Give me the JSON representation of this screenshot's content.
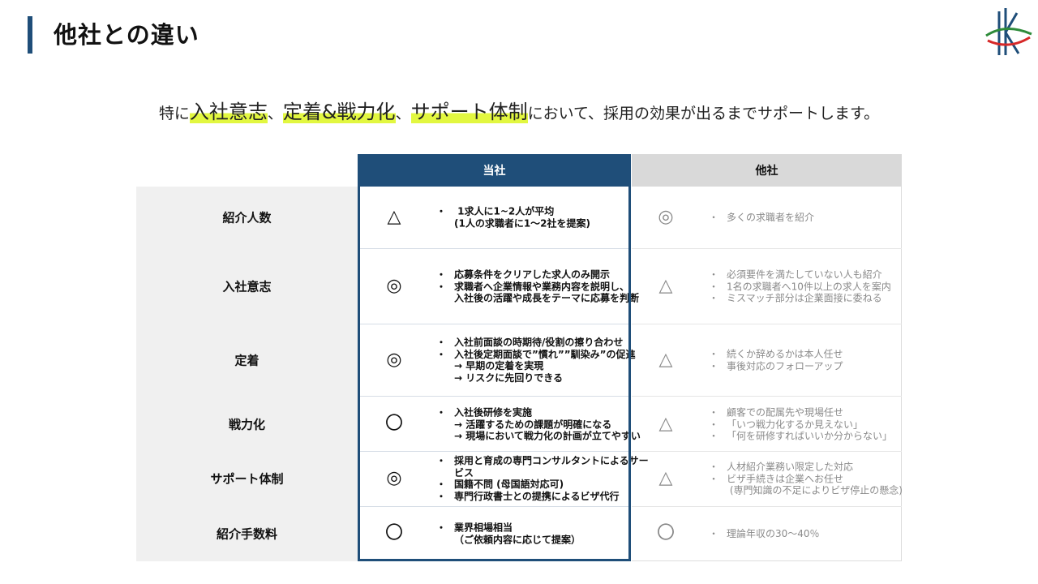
{
  "page": {
    "title": "他社との違い",
    "lead": {
      "p1": "特に",
      "h1": "入社意志",
      "p2": "、",
      "h2": "定着&戦力化",
      "p3": "、",
      "h3": "サポート体制",
      "p4": "において、採用の効果が出るまでサポートします。"
    }
  },
  "table": {
    "headers": {
      "ours": "当社",
      "other": "他社"
    },
    "rows": [
      {
        "label": "紹介人数",
        "ours_mark": "△",
        "ours": [
          {
            "text": " 1求人に1~2人が平均",
            "bullet": true
          },
          {
            "text": "(1人の求職者に1～2社を提案)",
            "bullet": false
          }
        ],
        "other_mark": "◎",
        "other": [
          {
            "text": "多くの求職者を紹介",
            "bullet": true
          }
        ]
      },
      {
        "label": "入社意志",
        "ours_mark": "◎",
        "ours": [
          {
            "text": "応募条件をクリアした求人のみ開示",
            "bullet": true
          },
          {
            "text": "求職者へ企業情報や業務内容を説明し、",
            "bullet": true
          },
          {
            "text": "入社後の活躍や成長をテーマに応募を判断",
            "bullet": false
          }
        ],
        "other_mark": "△",
        "other": [
          {
            "text": "必須要件を満たしていない人も紹介",
            "bullet": true
          },
          {
            "text": "1名の求職者へ10件以上の求人を案内",
            "bullet": true
          },
          {
            "text": "ミスマッチ部分は企業面接に委ねる",
            "bullet": true
          }
        ]
      },
      {
        "label": "定着",
        "ours_mark": "◎",
        "ours": [
          {
            "text": "入社前面談の時期待/役割の擦り合わせ",
            "bullet": true
          },
          {
            "text": "入社後定期面談で”慣れ””馴染み”の促進",
            "bullet": true
          },
          {
            "text": "→ 早期の定着を実現",
            "bullet": false
          },
          {
            "text": "→ リスクに先回りできる",
            "bullet": false
          }
        ],
        "other_mark": "△",
        "other": [
          {
            "text": "続くか辞めるかは本人任せ",
            "bullet": true
          },
          {
            "text": "事後対応のフォローアップ",
            "bullet": true
          }
        ]
      },
      {
        "label": "戦力化",
        "ours_mark": "〇",
        "ours": [
          {
            "text": "入社後研修を実施",
            "bullet": true
          },
          {
            "text": "→ 活躍するための課題が明確になる",
            "bullet": false
          },
          {
            "text": "→ 現場において戦力化の計画が立てやすい",
            "bullet": false
          }
        ],
        "other_mark": "△",
        "other": [
          {
            "text": "顧客での配属先や現場任せ",
            "bullet": true
          },
          {
            "text": "「いつ戦力化するか見えない」",
            "bullet": true
          },
          {
            "text": "「何を研修すればいいか分からない」",
            "bullet": true
          }
        ]
      },
      {
        "label": "サポート体制",
        "ours_mark": "◎",
        "ours": [
          {
            "text": "採用と育成の専門コンサルタントによるサー",
            "bullet": true
          },
          {
            "text": "ビス",
            "bullet": false
          },
          {
            "text": "国籍不問 (母国語対応可)",
            "bullet": true
          },
          {
            "text": "専門行政書士との提携によるビザ代行",
            "bullet": true
          }
        ],
        "other_mark": "△",
        "other": [
          {
            "text": "人材紹介業務い限定した対応",
            "bullet": true
          },
          {
            "text": "ビザ手続きは企業へお任せ",
            "bullet": true
          },
          {
            "text": " (専門知識の不足によりビザ停止の懸念)",
            "bullet": false
          }
        ]
      },
      {
        "label": "紹介手数料",
        "ours_mark": "〇",
        "ours": [
          {
            "text": "業界相場相当",
            "bullet": true
          },
          {
            "text": "（ご依頼内容に応じて提案）",
            "bullet": false
          }
        ],
        "other_mark": "〇",
        "other": [
          {
            "text": "理論年収の30～40％",
            "bullet": true
          }
        ]
      }
    ]
  },
  "colors": {
    "accent": "#1f4e79",
    "highlight": "#e2f740",
    "other_header": "#d9d9d9",
    "label_bg": "#f0f0f0"
  }
}
